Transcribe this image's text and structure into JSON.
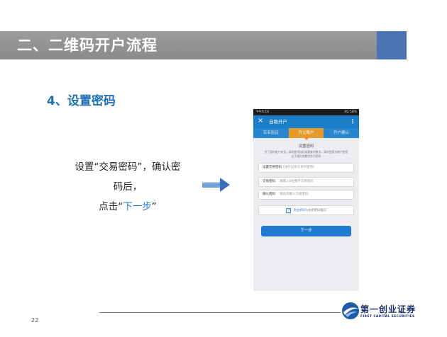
{
  "slide": {
    "header_title": "二、二维码开户流程",
    "step_title": "4、设置密码",
    "instruction": {
      "line1": "设置“交易密码”，确认密",
      "line2": "码后，",
      "line3_prefix": "点击“",
      "line3_link": "下一步",
      "line3_suffix": "”"
    },
    "page_number": "22",
    "logo_cn": "第一创业证券",
    "logo_en": "FIRST CAPITAL SECURITIES"
  },
  "phone": {
    "status_left": "下午6:16",
    "status_right": "4G 58%",
    "appbar_title": "自助开户",
    "tabs": [
      {
        "label": "实名验证"
      },
      {
        "label": "开立账户"
      },
      {
        "label": "开户确认"
      }
    ],
    "section_title": "设置密码",
    "note": "为了您的账户安全，请勿使用连续或重复的数字，请勿使用与账户信息过于相近的数字作为密码",
    "fields": [
      {
        "label": "设置交易密码",
        "hint": "(进行证券交易时使用)"
      },
      {
        "label": "交易密码",
        "placeholder": "请输入6位数字交易密码"
      },
      {
        "label": "确认密码",
        "placeholder": "请再次输入交易密码"
      }
    ],
    "checkbox_label_link": "资金密码",
    "checkbox_label_rest": "与交易密码相同",
    "next_button": "下一步"
  },
  "colors": {
    "accent_blue": "#1f7ad1",
    "tab_active": "#e49b28",
    "header_gray": "#909090",
    "banner_block": "#4a73b4"
  }
}
